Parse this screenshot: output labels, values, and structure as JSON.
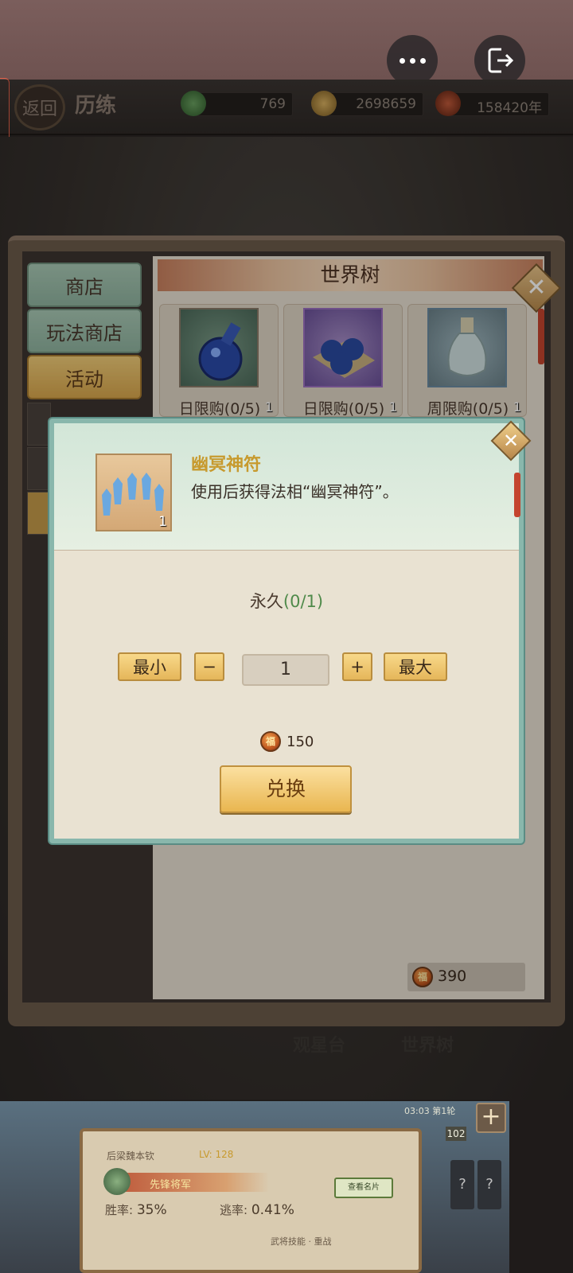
{
  "header": {
    "back_label": "返回",
    "title": "历练",
    "resources": [
      {
        "value": "769"
      },
      {
        "value": "2698659"
      },
      {
        "value": "158420年"
      }
    ]
  },
  "shop": {
    "tabs": [
      {
        "label": "商店",
        "active": false
      },
      {
        "label": "玩法商店",
        "active": false
      },
      {
        "label": "活动",
        "active": true
      }
    ],
    "panel_title": "世界树",
    "items": [
      {
        "qty": "1",
        "limit": "日限购(0/5)"
      },
      {
        "qty": "1",
        "limit": "日限购(0/5)"
      },
      {
        "qty": "1",
        "limit": "周限购(0/5)"
      }
    ],
    "balance": "390"
  },
  "modal": {
    "item_name": "幽冥神符",
    "item_qty": "1",
    "description": "使用后获得法相“幽冥神符”。",
    "limit_prefix": "永久",
    "limit_value": "(0/1)",
    "min_label": "最小",
    "minus_label": "−",
    "quantity": "1",
    "plus_label": "+",
    "max_label": "最大",
    "price": "150",
    "exchange_label": "兑换"
  },
  "background_labels": [
    "观星台",
    "世界树"
  ],
  "bottom_panel": {
    "general_name": "后梁魏本钦",
    "level": "LV: 128",
    "rank": "先锋将军",
    "view_card_label": "查看名片",
    "win_rate_label": "胜率:",
    "win_rate": "35%",
    "escape_rate_label": "逃率:",
    "escape_rate": "0.41%",
    "skill_label": "武将技能 · 重战",
    "badge": "102",
    "plus_label": "+",
    "timer": "03:03 第1轮"
  },
  "colors": {
    "accent_gold": "#e5b65a",
    "modal_border": "#89b7ac",
    "item_name_color": "#c79a2e",
    "limit_green": "#4f8a4a"
  }
}
